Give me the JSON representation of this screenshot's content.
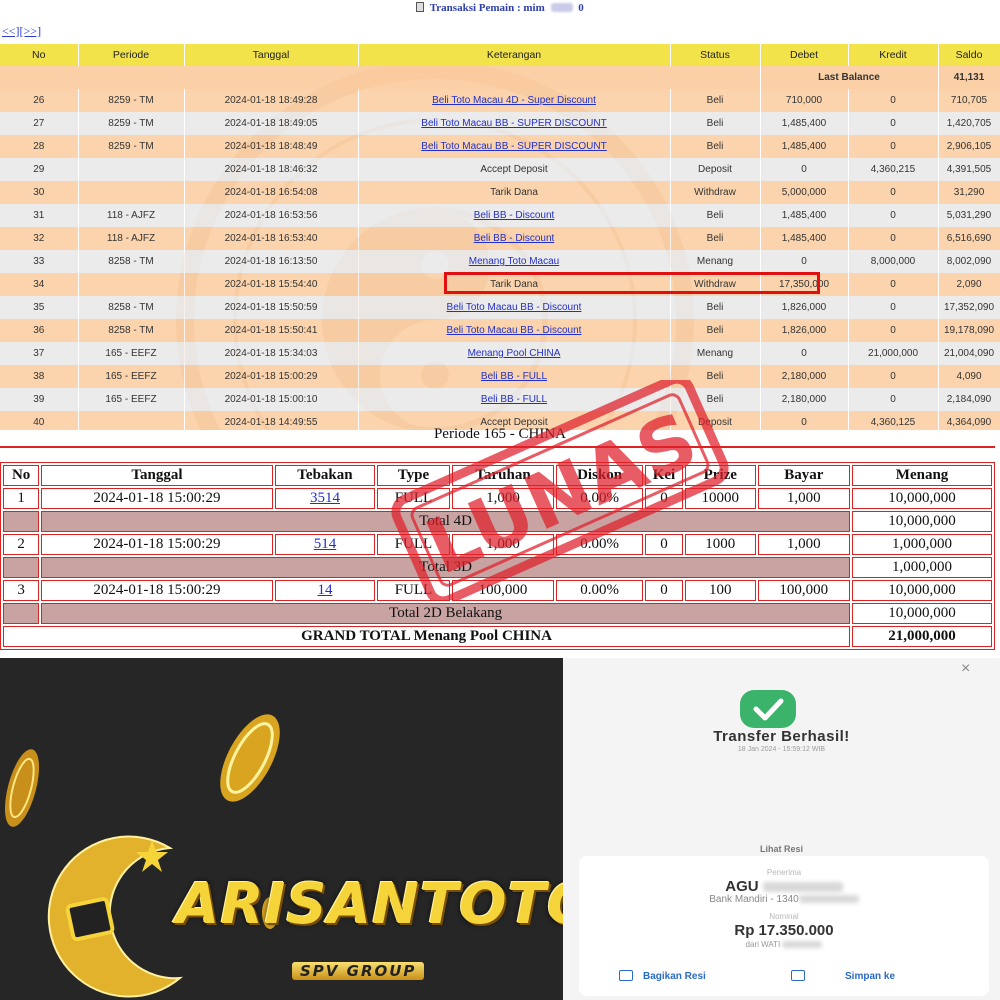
{
  "header": {
    "title_prefix": "Transaksi  Pemain : mim",
    "title_suffix": "0",
    "pager": "<<][>>]"
  },
  "tx_columns": [
    "No",
    "Periode",
    "Tanggal",
    "Keterangan",
    "Status",
    "Debet",
    "Kredit",
    "Saldo"
  ],
  "last_balance": {
    "label": "Last Balance",
    "value": "41,131"
  },
  "transactions": [
    {
      "no": "26",
      "periode": "8259 - TM",
      "tanggal": "2024-01-18 18:49:28",
      "ket": "Beli Toto Macau 4D - Super Discount",
      "link": true,
      "status": "Beli",
      "debet": "710,000",
      "kredit": "0",
      "saldo": "710,705"
    },
    {
      "no": "27",
      "periode": "8259 - TM",
      "tanggal": "2024-01-18 18:49:05",
      "ket": "Beli Toto Macau BB - SUPER DISCOUNT",
      "link": true,
      "status": "Beli",
      "debet": "1,485,400",
      "kredit": "0",
      "saldo": "1,420,705"
    },
    {
      "no": "28",
      "periode": "8259 - TM",
      "tanggal": "2024-01-18 18:48:49",
      "ket": "Beli Toto Macau BB - SUPER DISCOUNT",
      "link": true,
      "status": "Beli",
      "debet": "1,485,400",
      "kredit": "0",
      "saldo": "2,906,105"
    },
    {
      "no": "29",
      "periode": "",
      "tanggal": "2024-01-18 18:46:32",
      "ket": "Accept Deposit",
      "link": false,
      "status": "Deposit",
      "debet": "0",
      "kredit": "4,360,215",
      "saldo": "4,391,505"
    },
    {
      "no": "30",
      "periode": "",
      "tanggal": "2024-01-18 16:54:08",
      "ket": "Tarik Dana",
      "link": false,
      "status": "Withdraw",
      "debet": "5,000,000",
      "kredit": "0",
      "saldo": "31,290"
    },
    {
      "no": "31",
      "periode": "118 - AJFZ",
      "tanggal": "2024-01-18 16:53:56",
      "ket": "Beli BB - Discount",
      "link": true,
      "status": "Beli",
      "debet": "1,485,400",
      "kredit": "0",
      "saldo": "5,031,290"
    },
    {
      "no": "32",
      "periode": "118 - AJFZ",
      "tanggal": "2024-01-18 16:53:40",
      "ket": "Beli BB - Discount",
      "link": true,
      "status": "Beli",
      "debet": "1,485,400",
      "kredit": "0",
      "saldo": "6,516,690"
    },
    {
      "no": "33",
      "periode": "8258 - TM",
      "tanggal": "2024-01-18 16:13:50",
      "ket": "Menang Toto Macau",
      "link": true,
      "status": "Menang",
      "debet": "0",
      "kredit": "8,000,000",
      "saldo": "8,002,090"
    },
    {
      "no": "34",
      "periode": "",
      "tanggal": "2024-01-18 15:54:40",
      "ket": "Tarik Dana",
      "link": false,
      "status": "Withdraw",
      "debet": "17,350,000",
      "kredit": "0",
      "saldo": "2,090"
    },
    {
      "no": "35",
      "periode": "8258 - TM",
      "tanggal": "2024-01-18 15:50:59",
      "ket": "Beli Toto Macau BB - Discount",
      "link": true,
      "status": "Beli",
      "debet": "1,826,000",
      "kredit": "0",
      "saldo": "17,352,090"
    },
    {
      "no": "36",
      "periode": "8258 - TM",
      "tanggal": "2024-01-18 15:50:41",
      "ket": "Beli Toto Macau BB - Discount",
      "link": true,
      "status": "Beli",
      "debet": "1,826,000",
      "kredit": "0",
      "saldo": "19,178,090"
    },
    {
      "no": "37",
      "periode": "165 - EEFZ",
      "tanggal": "2024-01-18 15:34:03",
      "ket": "Menang Pool CHINA",
      "link": true,
      "status": "Menang",
      "debet": "0",
      "kredit": "21,000,000",
      "saldo": "21,004,090"
    },
    {
      "no": "38",
      "periode": "165 - EEFZ",
      "tanggal": "2024-01-18 15:00:29",
      "ket": "Beli BB - FULL",
      "link": true,
      "status": "Beli",
      "debet": "2,180,000",
      "kredit": "0",
      "saldo": "4,090"
    },
    {
      "no": "39",
      "periode": "165 - EEFZ",
      "tanggal": "2024-01-18 15:00:10",
      "ket": "Beli BB - FULL",
      "link": true,
      "status": "Beli",
      "debet": "2,180,000",
      "kredit": "0",
      "saldo": "2,184,090"
    },
    {
      "no": "40",
      "periode": "",
      "tanggal": "2024-01-18 14:49:55",
      "ket": "Accept Deposit",
      "link": false,
      "status": "Deposit",
      "debet": "0",
      "kredit": "4,360,125",
      "saldo": "4,364,090"
    }
  ],
  "periode_title": "Periode 165 - CHINA",
  "win_columns": [
    "No",
    "Tanggal",
    "Tebakan",
    "Type",
    "Taruhan",
    "Diskon",
    "Kei",
    "Prize",
    "Bayar",
    "Menang"
  ],
  "win_rows": [
    {
      "kind": "row",
      "no": "1",
      "tanggal": "2024-01-18 15:00:29",
      "tebakan": "3514",
      "type": "FULL",
      "taruhan": "1,000",
      "diskon": "0.00%",
      "kei": "0",
      "prize": "10000",
      "bayar": "1,000",
      "menang": "10,000,000"
    },
    {
      "kind": "total",
      "label": "Total 4D",
      "value": "10,000,000"
    },
    {
      "kind": "row",
      "no": "2",
      "tanggal": "2024-01-18 15:00:29",
      "tebakan": "514",
      "type": "FULL",
      "taruhan": "1,000",
      "diskon": "0.00%",
      "kei": "0",
      "prize": "1000",
      "bayar": "1,000",
      "menang": "1,000,000"
    },
    {
      "kind": "total",
      "label": "Total 3D",
      "value": "1,000,000"
    },
    {
      "kind": "row",
      "no": "3",
      "tanggal": "2024-01-18 15:00:29",
      "tebakan": "14",
      "type": "FULL",
      "taruhan": "100,000",
      "diskon": "0.00%",
      "kei": "0",
      "prize": "100",
      "bayar": "100,000",
      "menang": "10,000,000"
    },
    {
      "kind": "total",
      "label": "Total 2D Belakang",
      "value": "10,000,000"
    }
  ],
  "grand_total": {
    "label": "GRAND TOTAL  Menang Pool CHINA",
    "value": "21,000,000"
  },
  "stamp_text": "LUNAS",
  "brand": {
    "name": "ARISANTOTO",
    "sub": "SPV GROUP",
    "accent": "#f5d43a"
  },
  "receipt": {
    "close": "×",
    "title": "Transfer Berhasil!",
    "datetime": "18 Jan 2024 - 15:59:12 WIB",
    "lihat": "Lihat Resi",
    "penerima_label": "Penerima",
    "name": "AGU",
    "bank": "Bank Mandiri - 1340",
    "nominal_label": "Nominal",
    "amount": "Rp 17.350.000",
    "from": "dari WATI",
    "share": "Bagikan Resi",
    "save": "Simpan ke"
  },
  "colors": {
    "header_yellow": "#f3e34a",
    "row_peach": "#f8c896",
    "row_gray": "#e8e8e8",
    "red": "#d22",
    "link_blue": "#2230c8",
    "success_green": "#3bb36a"
  }
}
